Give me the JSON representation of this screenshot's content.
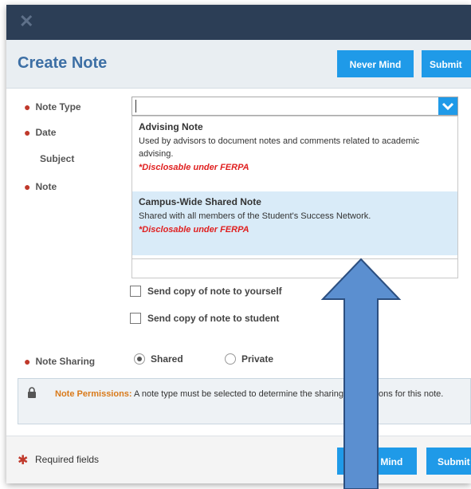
{
  "modal": {
    "close_glyph": "✕",
    "title": "Create Note",
    "header_buttons": {
      "never_mind": "Never Mind",
      "submit": "Submit"
    }
  },
  "form": {
    "note_type": {
      "label": "Note Type",
      "value": ""
    },
    "date": {
      "label": "Date"
    },
    "subject": {
      "label": "Subject"
    },
    "note": {
      "label": "Note"
    },
    "options": [
      {
        "title": "Advising Note",
        "description": "Used by advisors to document notes and comments related to academic advising.",
        "ferpa": "*Disclosable under FERPA"
      },
      {
        "title": "Campus-Wide Shared Note",
        "description": "Shared with all members of the Student's Success Network.",
        "ferpa": "*Disclosable under FERPA"
      }
    ],
    "send_copy_self": "Send copy of note to yourself",
    "send_copy_student": "Send copy of note to student",
    "note_sharing": {
      "label": "Note Sharing",
      "shared": "Shared",
      "private": "Private",
      "selected": "Shared"
    },
    "permissions": {
      "title": "Note Permissions:",
      "text": "A note type must be selected to determine the sharing permissions for this note."
    }
  },
  "footer": {
    "required_label": "Required fields",
    "never_mind": "Never Mind",
    "submit": "Submit"
  },
  "colors": {
    "topbar": "#2c3e56",
    "accent": "#1f9ae8",
    "title": "#3d6fa5",
    "required": "#c0392b",
    "ferpa": "#e02020",
    "annotation_arrow": "#5b8fd0"
  }
}
